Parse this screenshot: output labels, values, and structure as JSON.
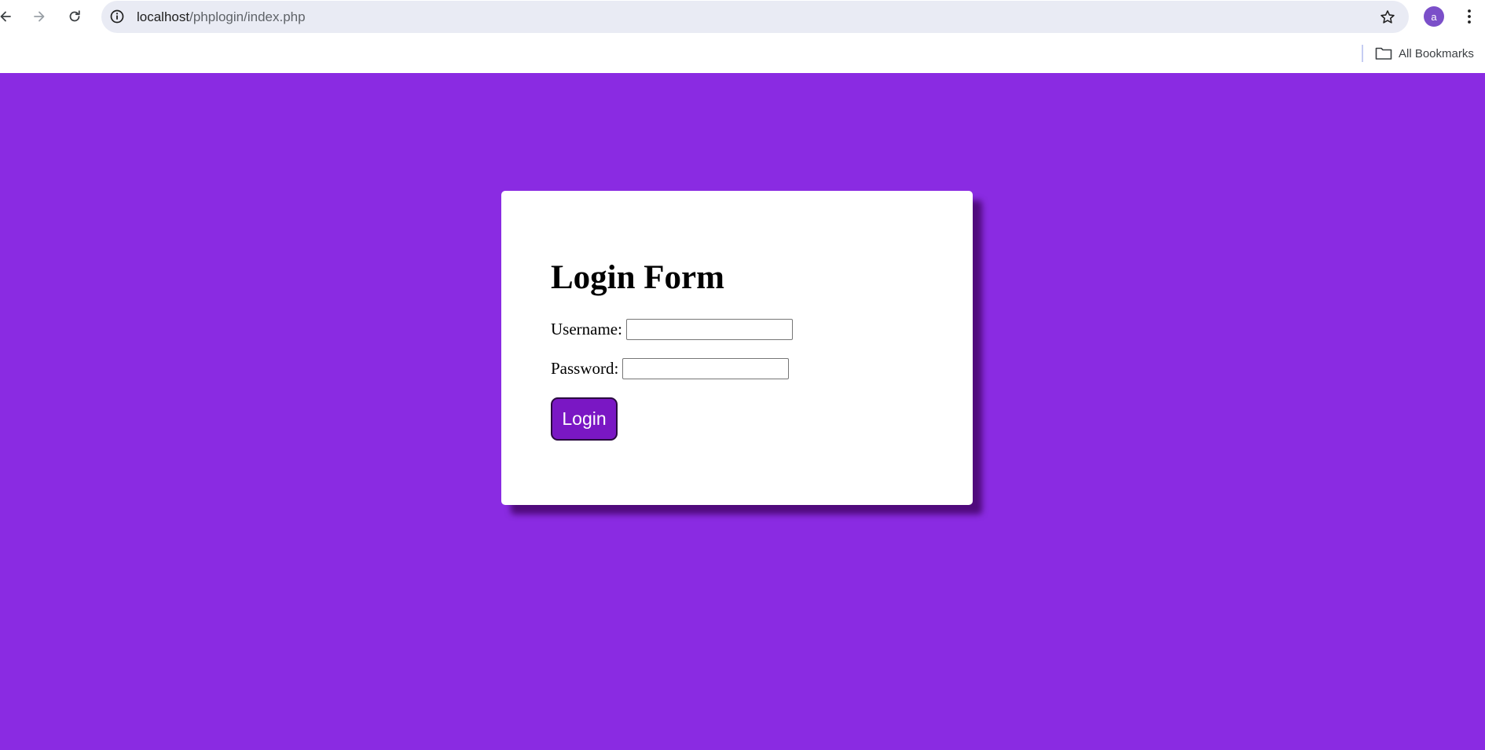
{
  "browser": {
    "url_host": "localhost",
    "url_path": "/phplogin/index.php",
    "profile_initial": "a",
    "bookmarks_folder": "All Bookmarks",
    "icons": {
      "back": "arrow-left-icon",
      "forward": "arrow-right-icon",
      "reload": "reload-icon",
      "site_info": "info-circle-icon",
      "bookmark": "star-icon",
      "menu": "vertical-dots-icon",
      "folder": "folder-icon"
    }
  },
  "page": {
    "background_color": "#8a2be2",
    "form": {
      "title": "Login Form",
      "username_label": "Username:",
      "username_value": "",
      "password_label": "Password:",
      "password_value": "",
      "submit_label": "Login",
      "submit_color": "#7a17c4"
    }
  }
}
